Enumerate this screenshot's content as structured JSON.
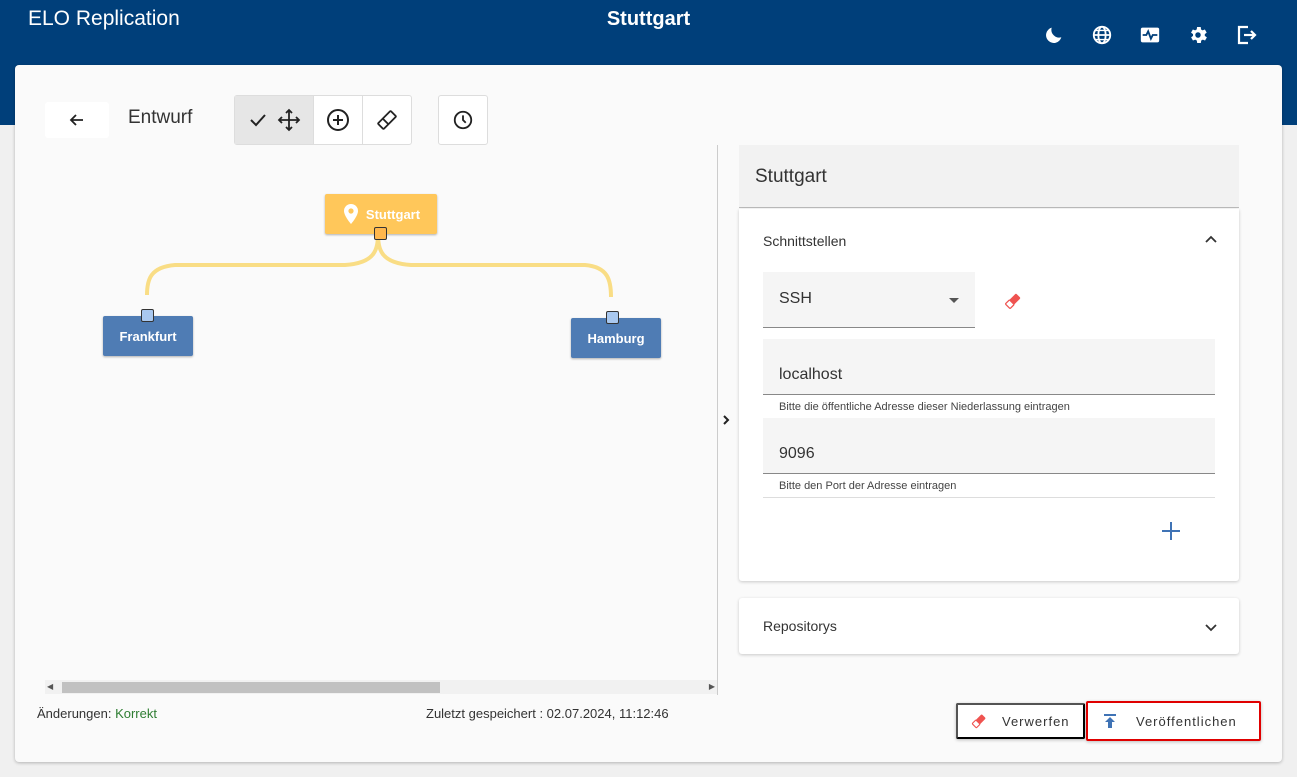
{
  "header": {
    "app_title": "ELO Replication",
    "page_title": "Stuttgart",
    "icons": [
      "moon-icon",
      "globe-icon",
      "monitor-pulse-icon",
      "gear-icon",
      "logout-icon"
    ]
  },
  "toolbar": {
    "draft_label": "Entwurf",
    "tools": [
      "select-move-icon",
      "add-node-icon",
      "eraser-icon"
    ],
    "history": "clock-icon"
  },
  "graph": {
    "root": {
      "label": "Stuttgart",
      "color": "#ffc75a"
    },
    "children": [
      {
        "label": "Frankfurt",
        "color": "#4f7cb4"
      },
      {
        "label": "Hamburg",
        "color": "#4f7cb4"
      }
    ],
    "edge_color": "#f9dd85"
  },
  "details": {
    "title": "Stuttgart",
    "interfaces": {
      "title": "Schnittstellen",
      "protocol": "SSH",
      "address_value": "localhost",
      "address_hint": "Bitte die öffentliche Adresse dieser Niederlassung eintragen",
      "port_value": "9096",
      "port_hint": "Bitte den Port der Adresse eintragen"
    },
    "repositories": {
      "title": "Repositorys"
    }
  },
  "footer": {
    "changes_label": "Änderungen:",
    "changes_status": "Korrekt",
    "saved": "Zuletzt gespeichert : 02.07.2024, 11:12:46"
  },
  "actions": {
    "discard_label": "Verwerfen",
    "publish_label": "Veröffentlichen"
  },
  "colors": {
    "header": "#003f7a",
    "accent": "#3f73b5",
    "ok": "#2e7d32",
    "highlight": "#e00000"
  }
}
